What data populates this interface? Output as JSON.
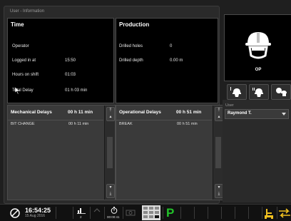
{
  "group_title": "User - Information",
  "time_panel": {
    "title": "Time",
    "rows": [
      {
        "label": "Operator",
        "value": ""
      },
      {
        "label": "Logged in at",
        "value": "15:50"
      },
      {
        "label": "Hours on shift",
        "value": "01:03"
      },
      {
        "label": "Total Delay",
        "value": "01 h 03 min"
      }
    ]
  },
  "production_panel": {
    "title": "Production",
    "rows": [
      {
        "label": "Drilled holes",
        "value": "0"
      },
      {
        "label": "Drilled depth",
        "value": "0.00 m"
      }
    ]
  },
  "mechanical_delays": {
    "title": "Mechanical Delays",
    "total": "00 h 11 min",
    "items": [
      {
        "name": "BIT CHANGE",
        "duration": "00 h 11 min"
      }
    ]
  },
  "operational_delays": {
    "title": "Operational Delays",
    "total": "00 h 51 min",
    "items": [
      {
        "name": "BREAK",
        "duration": "00 h 51 min"
      }
    ]
  },
  "operator_role": {
    "label": "OP"
  },
  "user": {
    "label": "User",
    "selected": "Raymond T."
  },
  "taskbar": {
    "time": "16:54:25",
    "date": "15 Aug 2016",
    "count": "2",
    "timer": "00:00:41",
    "mode_letter": "P"
  },
  "colors": {
    "accent_green": "#22c22a",
    "accent_yellow": "#f0c020"
  }
}
